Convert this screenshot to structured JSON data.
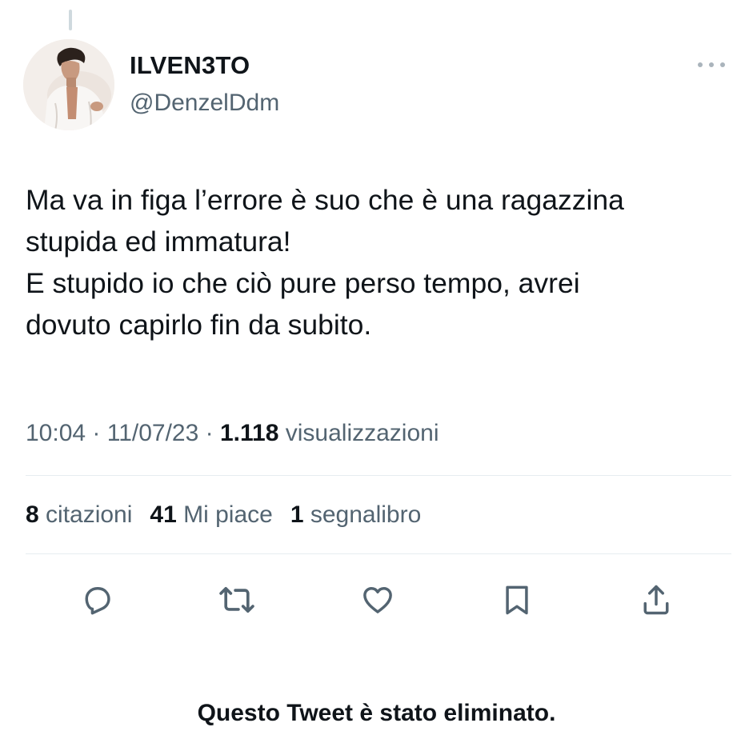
{
  "author": {
    "display_name": "ILVEN3TO",
    "handle": "@DenzelDdm",
    "avatar_icon": "profile-photo"
  },
  "tweet": {
    "lines": [
      "Ma va in figa l’errore è suo che è una ragazzina",
      "stupida ed immatura!",
      "E stupido io che ciò pure perso tempo, avrei",
      "dovuto capirlo fin da subito."
    ]
  },
  "meta": {
    "time": "10:04",
    "separator": " · ",
    "date": "11/07/23",
    "views_count": "1.118",
    "views_label": " visualizzazioni"
  },
  "stats": {
    "quotes_count": "8",
    "quotes_label": " citazioni",
    "likes_count": "41",
    "likes_label": " Mi piace",
    "bookmarks_count": "1",
    "bookmarks_label": " segnalibro"
  },
  "actions": [
    {
      "icon": "reply-icon"
    },
    {
      "icon": "retweet-icon"
    },
    {
      "icon": "like-icon"
    },
    {
      "icon": "bookmark-icon"
    },
    {
      "icon": "share-icon"
    }
  ],
  "status_message": "Questo Tweet è stato eliminato.",
  "colors": {
    "text_primary": "#0f1419",
    "text_secondary": "#536471",
    "divider": "#e6ecf0",
    "thread_line": "#cfd9de"
  }
}
